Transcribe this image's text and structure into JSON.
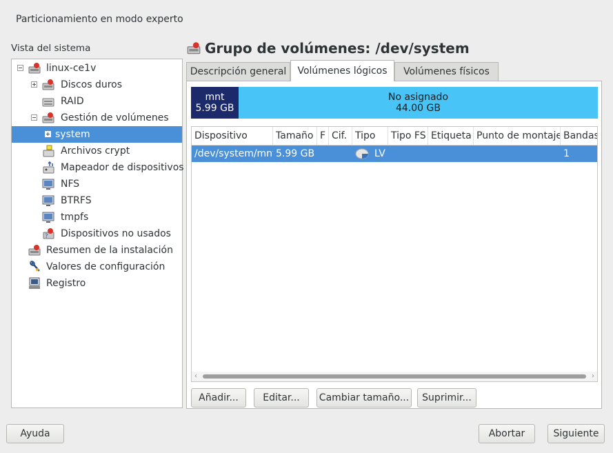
{
  "window": {
    "title": "Particionamiento en modo experto"
  },
  "sidebar": {
    "title": "Vista del sistema",
    "items": [
      {
        "label": "linux-ce1v"
      },
      {
        "label": "Discos duros"
      },
      {
        "label": "RAID"
      },
      {
        "label": "Gestión de volúmenes"
      },
      {
        "label": "system"
      },
      {
        "label": "Archivos crypt"
      },
      {
        "label": "Mapeador de dispositivos"
      },
      {
        "label": "NFS"
      },
      {
        "label": "BTRFS"
      },
      {
        "label": "tmpfs"
      },
      {
        "label": "Dispositivos no usados"
      },
      {
        "label": "Resumen de la instalación"
      },
      {
        "label": "Valores de configuración"
      },
      {
        "label": "Registro"
      }
    ]
  },
  "main": {
    "title": "Grupo de volúmenes: /dev/system",
    "tabs": [
      {
        "label": "Descripción general"
      },
      {
        "label": "Volúmenes lógicos"
      },
      {
        "label": "Volúmenes físicos"
      }
    ],
    "bar": {
      "mnt_label": "mnt",
      "mnt_size": "5.99 GB",
      "free_label": "No asignado",
      "free_size": "44.00 GB",
      "mnt_color": "#1c2a6b",
      "free_color": "#49c4f6"
    },
    "table": {
      "headers": [
        "Dispositivo",
        "Tamaño",
        "F",
        "Cif.",
        "Tipo",
        "Tipo FS",
        "Etiqueta",
        "Punto de montaje",
        "Bandas"
      ],
      "rows": [
        {
          "device": "/dev/system/mnt",
          "size": "5.99 GB",
          "f": "",
          "enc": "",
          "type": "LV",
          "fstype": "",
          "label": "",
          "mount": "",
          "stripes": "1"
        }
      ]
    },
    "buttons": {
      "add": "Añadir...",
      "edit": "Editar...",
      "resize": "Cambiar tamaño...",
      "delete": "Suprimir..."
    }
  },
  "footer": {
    "help": "Ayuda",
    "abort": "Abortar",
    "next": "Siguiente"
  },
  "colors": {
    "selection": "#4a90d9"
  }
}
